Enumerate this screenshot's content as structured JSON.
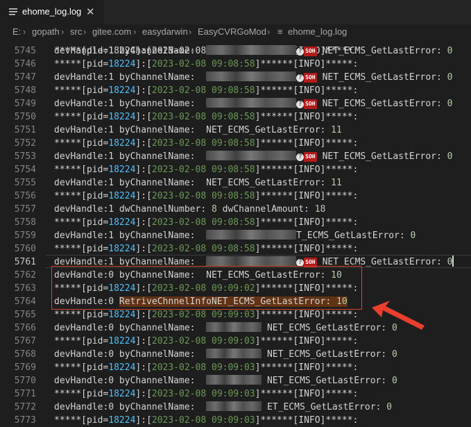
{
  "tab": {
    "filename": "ehome_log.log",
    "close": "✕",
    "icon": "file-lines-icon"
  },
  "breadcrumb": [
    "E:",
    "gopath",
    "src",
    "gitee.com",
    "easydarwin",
    "EasyCVRGoMod",
    "ehome_log.log"
  ],
  "breadcrumb_sep": "›",
  "strings": {
    "bycn": "devHandle:1 byChannelName: ",
    "bycn0": "devHandle:0 byChannelName: ",
    "neterr": "NET_ECMS_GetLastError: ",
    "pid_pre": "*****[pid=",
    "pid": "18224",
    "mid": "]:[",
    "tail": "]******[INFO]*****:",
    "soh": "SOH",
    "q": "?"
  },
  "lines": [
    {
      "n": "5745",
      "text": "devHandle:1 byChannelName:",
      "err": "NET_ECMS_GetLastError:",
      "val": "0"
    },
    {
      "n": "5746",
      "date": "2023-02-08 09:08:58"
    },
    {
      "n": "5747",
      "text": "devHandle:1 byChannelName:",
      "err": "NET_ECMS_GetLastError:",
      "val": "0"
    },
    {
      "n": "5748",
      "date": "2023-02-08 09:08:58"
    },
    {
      "n": "5749",
      "text": "devHandle:1 byChannelName:",
      "err": "NET_ECMS_GetLastError:",
      "val": "0"
    },
    {
      "n": "5750",
      "date": "2023-02-08 09:08:58"
    },
    {
      "n": "5751",
      "text": "devHandle:1 byChannelName:",
      "err": "NET_ECMS_GetLastError:",
      "val": "11"
    },
    {
      "n": "5752",
      "date": "2023-02-08 09:08:58"
    },
    {
      "n": "5753",
      "text": "devHandle:1 byChannelName:",
      "err": "NET_ECMS_GetLastError:",
      "val": "0"
    },
    {
      "n": "5754",
      "date": "2023-02-08 09:08:58"
    },
    {
      "n": "5755",
      "text": "devHandle:1 byChannelName:",
      "err": "NET_ECMS_GetLastError:",
      "val": "11"
    },
    {
      "n": "5756",
      "date": "2023-02-08 09:08:58"
    },
    {
      "n": "5757",
      "text": "devHandle:1 dwChannelNumber:",
      "v1": "8",
      "mid": "dwChannelAmount:",
      "val": "18"
    },
    {
      "n": "5758",
      "date": "2023-02-08 09:08:58"
    },
    {
      "n": "5759",
      "text": "devHandle:1 byChannelName:",
      "err": "T_ECMS_GetLastError:",
      "val": "0"
    },
    {
      "n": "5760",
      "date": "2023-02-08 09:08:58"
    },
    {
      "n": "5761",
      "text": "devHandle:1 byChannelName:",
      "err": "NET_ECMS_GetLastError:",
      "val": "0"
    },
    {
      "n": "5762",
      "text": "devHandle:0 byChannelName:",
      "err": "NET_ECMS_GetLastError:",
      "val": "10"
    },
    {
      "n": "5763",
      "date": "2023-02-08 09:09:02"
    },
    {
      "n": "5764",
      "text": "devHandle:0",
      "hl": "RetriveChnnelInfoNET_ECMS_GetLastError:",
      "val": "10"
    },
    {
      "n": "5765",
      "date": "2023-02-08 09:09:03"
    },
    {
      "n": "5766",
      "text": "devHandle:0 byChannelName:",
      "err": "NET_ECMS_GetLastError:",
      "val": "0"
    },
    {
      "n": "5767",
      "date": "2023-02-08 09:09:03"
    },
    {
      "n": "5768",
      "text": "devHandle:0 byChannelName:",
      "err": "NET_ECMS_GetLastError:",
      "val": "0"
    },
    {
      "n": "5769",
      "date": "2023-02-08 09:09:03"
    },
    {
      "n": "5770",
      "text": "devHandle:0 byChannelName:",
      "err": "NET_ECMS_GetLastError:",
      "val": "0"
    },
    {
      "n": "5771",
      "date": "2023-02-08 09:09:03"
    },
    {
      "n": "5772",
      "text": "devHandle:0 byChannelName:",
      "err": "ET_ECMS_GetLastError:",
      "val": "0"
    },
    {
      "n": "5773",
      "date": "2023-02-08 09:09:03"
    }
  ],
  "partial_top": "*****[pid=18224]:[2023-02-08 09:08:58]******[INFO]*****:",
  "colors": {
    "accent_box": "#d9442a",
    "arrow": "#e8402c",
    "highlight": "#613214"
  }
}
